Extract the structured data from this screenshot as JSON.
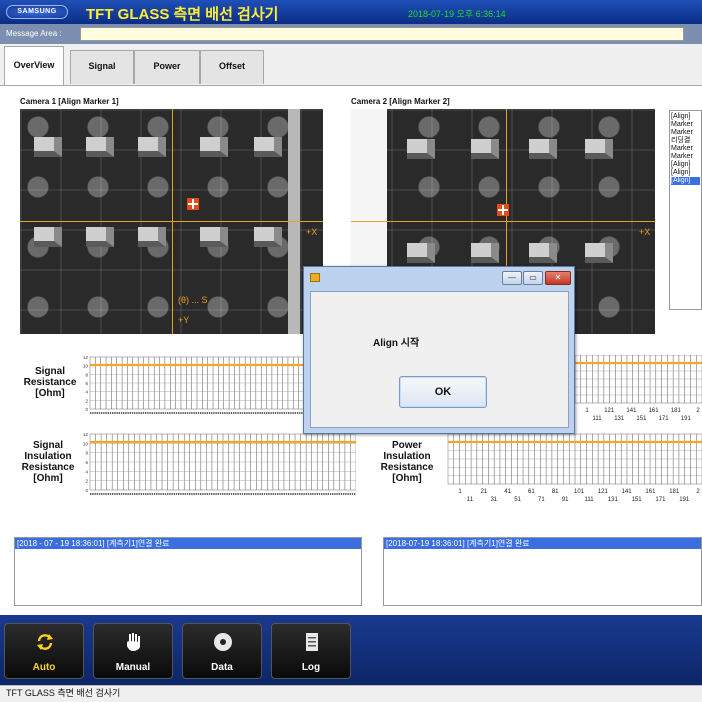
{
  "title_bar": {
    "logo": "SAMSUNG",
    "title": "TFT GLASS 측면 배선 검사기",
    "datetime": "2018-07-19 오후 6:36:14"
  },
  "message_area": {
    "label": "Message Area :",
    "value": ""
  },
  "tabs": [
    {
      "label": "OverView",
      "active": true
    },
    {
      "label": "Signal",
      "active": false
    },
    {
      "label": "Power",
      "active": false
    },
    {
      "label": "Offset",
      "active": false
    }
  ],
  "cameras": {
    "camera1": {
      "label": "Camera 1 [Align Marker 1]",
      "x_axis": "+X",
      "y_axis": "+Y",
      "theta": "(θ) ... S"
    },
    "camera2": {
      "label": "Camera 2 [Align Marker 2]",
      "x_axis": "+X"
    }
  },
  "side_log": {
    "items": [
      "[Align]",
      "Marker",
      "Marker",
      "리딩결",
      "Marker",
      "Marker",
      "[Align]",
      "[Align]",
      "[Align]"
    ],
    "selected_index": 8
  },
  "charts": {
    "signal_resistance": {
      "label_lines": [
        "Signal",
        "Resistance",
        "[Ohm]"
      ],
      "y_ticks": [
        "12",
        "10",
        "8",
        "6",
        "4",
        "2",
        "0"
      ]
    },
    "signal_insulation": {
      "label_lines": [
        "Signal",
        "Insulation",
        "Resistance",
        "[Ohm]"
      ],
      "y_ticks": [
        "12",
        "10",
        "8",
        "6",
        "4",
        "2",
        "0"
      ]
    },
    "power_insulation": {
      "label_lines": [
        "Power",
        "Insulation",
        "Resistance",
        "[Ohm]"
      ],
      "x_ticks_top": [
        "1",
        "21",
        "41",
        "61",
        "81",
        "101",
        "121",
        "141",
        "161",
        "181",
        "2"
      ],
      "x_ticks_bottom": [
        "11",
        "31",
        "51",
        "71",
        "91",
        "111",
        "131",
        "151",
        "171",
        "191"
      ]
    },
    "power_resistance": {
      "x_ticks_top": [
        "1",
        "121",
        "141",
        "161",
        "181",
        "2"
      ],
      "x_ticks_bottom": [
        "111",
        "131",
        "151",
        "171",
        "191"
      ]
    }
  },
  "log_panels": {
    "left": "[2018 - 07 - 19 18:36:01] [계측기1]연결 완료",
    "right": "[2018-07-19 18:36:01] [계측기1]연결 완료"
  },
  "nav": [
    {
      "label": "Auto",
      "icon": "refresh-icon",
      "active": true
    },
    {
      "label": "Manual",
      "icon": "hand-icon",
      "active": false
    },
    {
      "label": "Data",
      "icon": "disc-icon",
      "active": false
    },
    {
      "label": "Log",
      "icon": "document-icon",
      "active": false
    }
  ],
  "status_bar": "TFT GLASS 측면 배선 검사기",
  "dialog": {
    "message": "Align 시작",
    "ok_label": "OK",
    "minimize": "—",
    "restore": "▭",
    "close": "✕"
  },
  "colors": {
    "title_bg": "#0b2e86",
    "title_text": "#ffee33",
    "datetime": "#22dd22",
    "crosshair": "#e8a020",
    "chart_line": "#f5a623",
    "selection": "#3b6fe0"
  }
}
